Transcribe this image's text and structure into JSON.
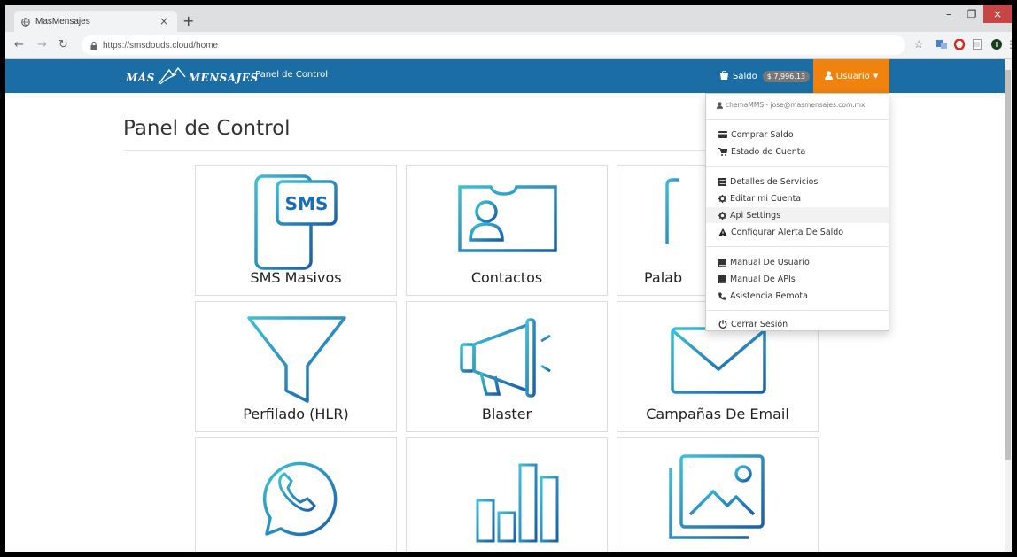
{
  "browser": {
    "tab_title": "MasMensajes",
    "tab_close": "×",
    "new_tab": "+",
    "url": "https://smsdouds.cloud/home",
    "window_minimize": "–",
    "window_maximize": "❐",
    "window_close": "×"
  },
  "navbar": {
    "brand_left": "MÁS",
    "brand_right": "MENSAJES",
    "panel_link": "Panel de Control",
    "saldo_label": "Saldo",
    "saldo_amount": "$ 7,996.13",
    "user_menu_label": "Usuario",
    "accent_color": "#1b6ea5",
    "user_button_color": "#f0820e"
  },
  "page": {
    "title": "Panel de Control"
  },
  "cards": [
    {
      "label": "SMS Masivos",
      "icon": "sms-phone-icon"
    },
    {
      "label": "Contactos",
      "icon": "contact-card-icon"
    },
    {
      "label": "Palab",
      "icon": "keyword-icon"
    },
    {
      "label": "Perfilado (HLR)",
      "icon": "funnel-icon"
    },
    {
      "label": "Blaster",
      "icon": "megaphone-icon"
    },
    {
      "label": "Campañas De Email",
      "icon": "envelope-icon"
    },
    {
      "label": "",
      "icon": "whatsapp-icon"
    },
    {
      "label": "",
      "icon": "bar-chart-icon"
    },
    {
      "label": "",
      "icon": "image-gallery-icon"
    }
  ],
  "dropdown": {
    "user_line": "chemaMMS - jose@masmensajes.com.mx",
    "items": [
      {
        "label": "Comprar Saldo",
        "icon": "credit-card-icon"
      },
      {
        "label": "Estado de Cuenta",
        "icon": "cart-icon"
      },
      {
        "label": "Detalles de Servicios",
        "icon": "list-icon"
      },
      {
        "label": "Editar mi Cuenta",
        "icon": "gear-icon"
      },
      {
        "label": "Api Settings",
        "icon": "gear-icon"
      },
      {
        "label": "Configurar Alerta De Saldo",
        "icon": "warning-icon"
      },
      {
        "label": "Manual De Usuario",
        "icon": "book-icon"
      },
      {
        "label": "Manual De APIs",
        "icon": "book-icon"
      },
      {
        "label": "Asistencia Remota",
        "icon": "phone-icon"
      },
      {
        "label": "Cerrar Sesión",
        "icon": "power-icon"
      }
    ]
  }
}
